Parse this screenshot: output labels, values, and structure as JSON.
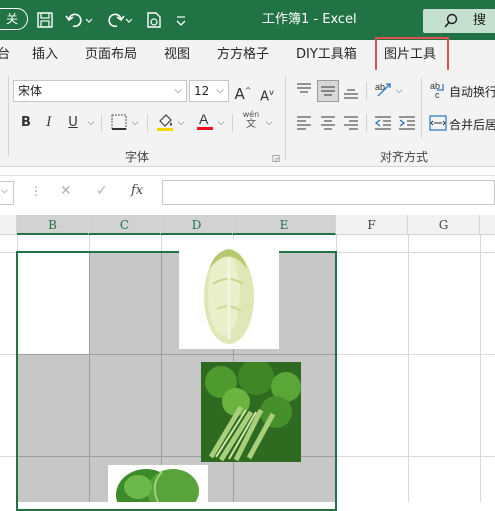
{
  "titlebar": {
    "account_label": "关",
    "title": "工作簿1 - Excel",
    "search_label": "搜",
    "qat_icons": [
      "save-icon",
      "undo-icon",
      "redo-icon",
      "print-preview-icon",
      "customize-qat-icon"
    ]
  },
  "tabs": [
    {
      "label": "台"
    },
    {
      "label": "插入"
    },
    {
      "label": "页面布局"
    },
    {
      "label": "视图"
    },
    {
      "label": "方方格子"
    },
    {
      "label": "DIY工具箱"
    },
    {
      "label": "图片工具"
    }
  ],
  "ribbon": {
    "font_name": "宋体",
    "font_size": "12",
    "bold": "B",
    "italic": "I",
    "underline": "U",
    "phonetic_top": "wén",
    "phonetic_bottom": "文",
    "font_group_label": "字体",
    "align_group_label": "对齐方式",
    "wrap_text_label": "自动换行",
    "merge_label": "合并后居",
    "grow_font": "A",
    "shrink_font": "A",
    "highlight_color": "#f2d800",
    "font_color": "#e81123"
  },
  "formula_bar": {
    "cancel": "✕",
    "enter": "✓",
    "fx": "fx",
    "value": ""
  },
  "grid": {
    "columns": [
      "B",
      "C",
      "D",
      "E",
      "F",
      "G"
    ]
  },
  "images": [
    {
      "name": "chinese-cabbage-image"
    },
    {
      "name": "celery-image"
    },
    {
      "name": "bok-choy-image"
    }
  ]
}
